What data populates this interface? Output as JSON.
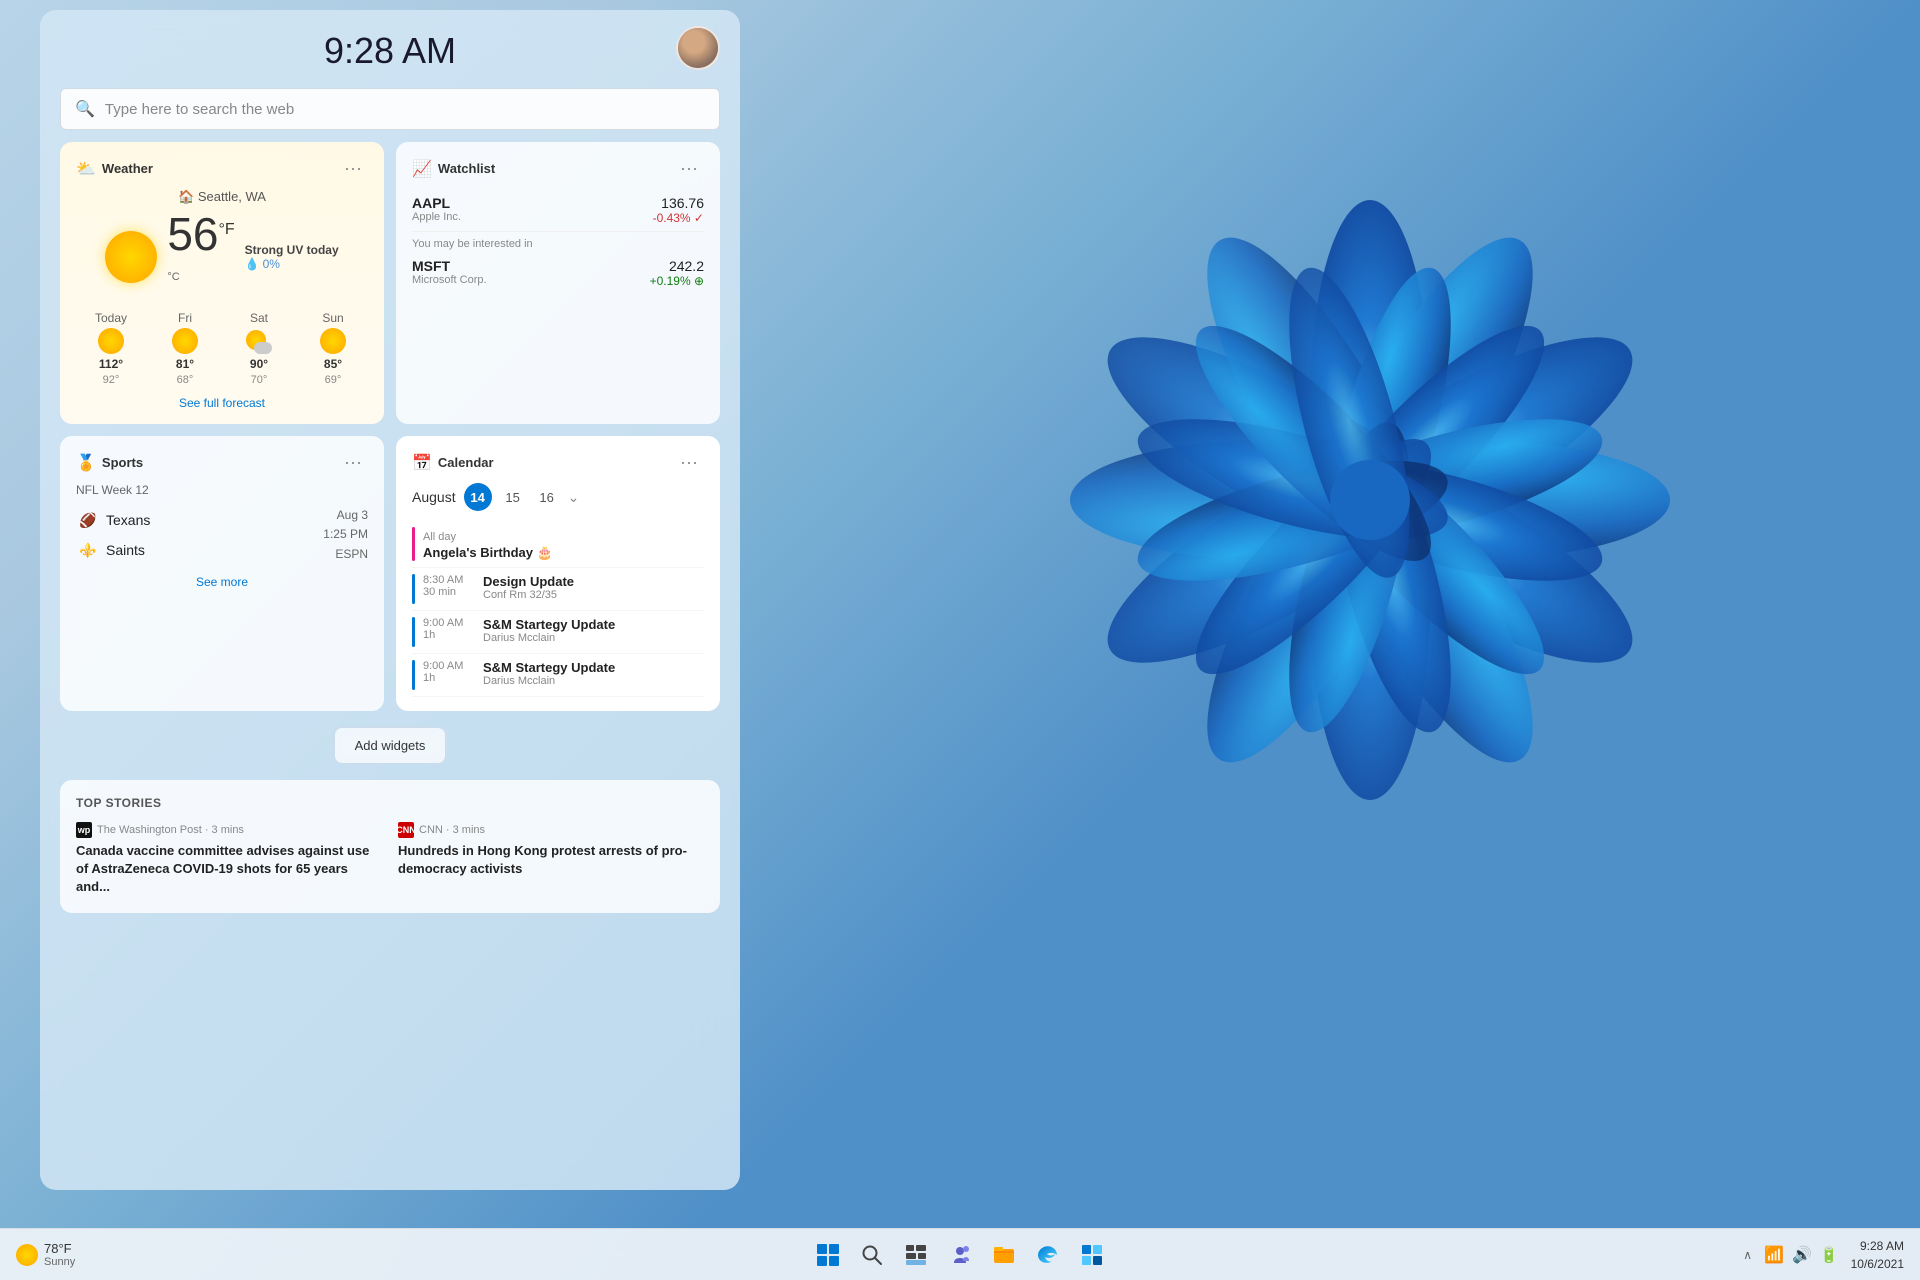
{
  "desktop": {
    "time": "9:28 AM",
    "search_placeholder": "Type here to search the web"
  },
  "weather_widget": {
    "title": "Weather",
    "location": "Seattle, WA",
    "temperature": "56",
    "uv_text": "Strong UV today",
    "precip": "0%",
    "forecast": [
      {
        "day": "Today",
        "high": "112°",
        "low": "92°",
        "type": "sun"
      },
      {
        "day": "Fri",
        "high": "81°",
        "low": "68°",
        "type": "sun"
      },
      {
        "day": "Sat",
        "high": "90°",
        "low": "70°",
        "type": "partly"
      },
      {
        "day": "Sun",
        "high": "85°",
        "low": "69°",
        "type": "sun"
      }
    ],
    "see_full_forecast": "See full forecast"
  },
  "watchlist_widget": {
    "title": "Watchlist",
    "stocks": [
      {
        "ticker": "AAPL",
        "company": "Apple Inc.",
        "price": "136.76",
        "change": "-0.43%",
        "direction": "down"
      }
    ],
    "interest_label": "You may be interested in",
    "suggested": [
      {
        "ticker": "MSFT",
        "company": "Microsoft Corp.",
        "price": "242.2",
        "change": "+0.19%",
        "direction": "up"
      }
    ]
  },
  "calendar_widget": {
    "title": "Calendar",
    "month": "August",
    "dates": [
      "14",
      "15",
      "16"
    ],
    "active_date": "14",
    "events": [
      {
        "type": "allday",
        "bar_color": "pink",
        "time": "All day",
        "title": "Angela's Birthday 🎂",
        "subtitle": ""
      },
      {
        "type": "timed",
        "bar_color": "blue",
        "time": "8:30 AM",
        "duration": "30 min",
        "title": "Design Update",
        "subtitle": "Conf Rm 32/35"
      },
      {
        "type": "timed",
        "bar_color": "blue",
        "time": "9:00 AM",
        "duration": "1h",
        "title": "S&M Startegy Update",
        "subtitle": "Darius Mcclain"
      },
      {
        "type": "timed",
        "bar_color": "blue",
        "time": "9:00 AM",
        "duration": "1h",
        "title": "S&M Startegy Update",
        "subtitle": "Darius Mcclain"
      }
    ]
  },
  "sports_widget": {
    "title": "Sports",
    "week": "NFL Week 12",
    "game": {
      "team1": "Texans",
      "team1_emoji": "🏈",
      "team2": "Saints",
      "team2_emoji": "⚜️",
      "date": "Aug 3",
      "time": "1:25 PM",
      "network": "ESPN"
    },
    "see_more": "See more"
  },
  "add_widgets": {
    "label": "Add widgets"
  },
  "top_stories": {
    "title": "TOP STORIES",
    "articles": [
      {
        "source": "The Washington Post",
        "source_abbr": "wp",
        "time": "3 mins",
        "headline": "Canada vaccine committee advises against use of AstraZeneca COVID-19 shots for 65 years and..."
      },
      {
        "source": "CNN",
        "source_abbr": "cnn",
        "time": "3 mins",
        "headline": "Hundreds in Hong Kong protest arrests of pro-democracy activists"
      }
    ]
  },
  "taskbar": {
    "weather_temp": "78°F",
    "weather_condition": "Sunny",
    "time": "9:28 AM",
    "date": "10/6/2021"
  }
}
